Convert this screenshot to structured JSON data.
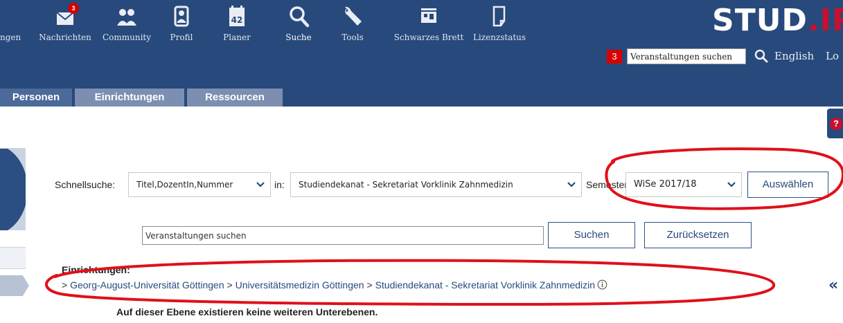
{
  "nav": {
    "items": [
      {
        "label": "ngen",
        "icon": "home-icon"
      },
      {
        "label": "Nachrichten",
        "icon": "mail-icon",
        "badge": "3"
      },
      {
        "label": "Community",
        "icon": "people-icon"
      },
      {
        "label": "Profil",
        "icon": "user-icon"
      },
      {
        "label": "Planer",
        "icon": "calendar-icon"
      },
      {
        "label": "Suche",
        "icon": "search-icon"
      },
      {
        "label": "Tools",
        "icon": "wrench-icon"
      },
      {
        "label": "Schwarzes Brett",
        "icon": "board-icon"
      },
      {
        "label": "Lizenzstatus",
        "icon": "document-icon"
      }
    ],
    "calendar_day": "42",
    "logo_main": "STUD",
    "logo_dot": ".IP"
  },
  "util": {
    "badge": "3",
    "search_value": "Veranstaltungen suchen",
    "language": "English",
    "login": "Lo"
  },
  "tabs": [
    "Personen",
    "Einrichtungen",
    "Ressourcen"
  ],
  "quick_search": {
    "label": "Schnellsuche:",
    "field_select": "Titel,DozentIn,Nummer",
    "in_label": "in:",
    "scope_select": "Studiendekanat - Sekretariat Vorklinik Zahnmedizin",
    "semester_label": "Semester:",
    "semester_select": "WiSe 2017/18",
    "select_button": "Auswählen",
    "search_value": "Veranstaltungen suchen",
    "search_button": "Suchen",
    "reset_button": "Zurücksetzen"
  },
  "institutions": {
    "heading": "Einrichtungen:",
    "path": [
      "Georg-August-Universität Göttingen",
      "Universitätsmedizin Göttingen",
      "Studiendekanat - Sekretariat Vorklinik Zahnmedizin"
    ],
    "separator": " > ",
    "no_sublevels": "Auf dieser Ebene existieren keine weiteren Unterebenen.",
    "collapse": "«"
  },
  "colors": {
    "nav_bg": "#28497c",
    "tab_active": "#4b6a99",
    "tab_inactive": "#7c8fb1",
    "badge_red": "#d60000",
    "annotation_red": "#e0101a",
    "link_blue": "#28497c"
  }
}
